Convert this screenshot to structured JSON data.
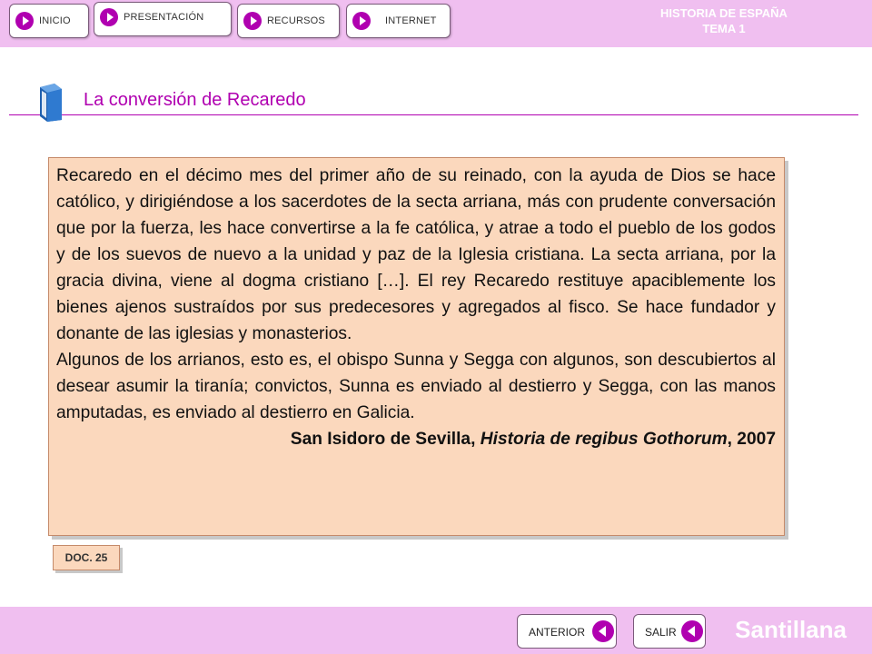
{
  "nav": {
    "items": [
      {
        "label": "INICIO"
      },
      {
        "label": "PRESENTACIÓN"
      },
      {
        "label": "RECURSOS"
      },
      {
        "label": "INTERNET"
      }
    ]
  },
  "header": {
    "title_line1": "HISTORIA DE ESPAÑA",
    "title_line2": "TEMA 1"
  },
  "page": {
    "title": "La conversión de Recaredo"
  },
  "document": {
    "paragraph1": "Recaredo en el décimo mes del primer año de su reinado, con la ayuda de Dios se hace católico, y dirigiéndose a los sacerdotes de la secta arriana, más con prudente conversación que por la fuerza, les hace convertirse a la fe católica, y atrae a todo el pueblo de los godos y de los suevos de nuevo a la unidad y paz de la Iglesia cristiana. La secta arriana, por la gracia divina, viene al dogma cristiano […]. El rey Recaredo restituye apaciblemente los bienes ajenos sustraídos por sus predecesores y agregados al fisco. Se hace fundador y donante de las iglesias y monasterios.",
    "paragraph2": "Algunos de los arrianos, esto es, el obispo Sunna y Segga con algunos, son descubiertos al desear asumir la tiranía; convictos, Sunna es enviado al destierro y Segga, con las manos amputadas, es enviado al destierro en Galicia.",
    "attribution_author": "San Isidoro de Sevilla, ",
    "attribution_work": "Historia de regibus Gothorum",
    "attribution_year": ", 2007",
    "badge": "DOC. 25"
  },
  "footer": {
    "prev_label": "ANTERIOR",
    "exit_label": "SALIR",
    "brand": "Santillana"
  },
  "colors": {
    "bar": "#f0bff0",
    "accent": "#b000b0",
    "box": "#fbd8bd"
  }
}
